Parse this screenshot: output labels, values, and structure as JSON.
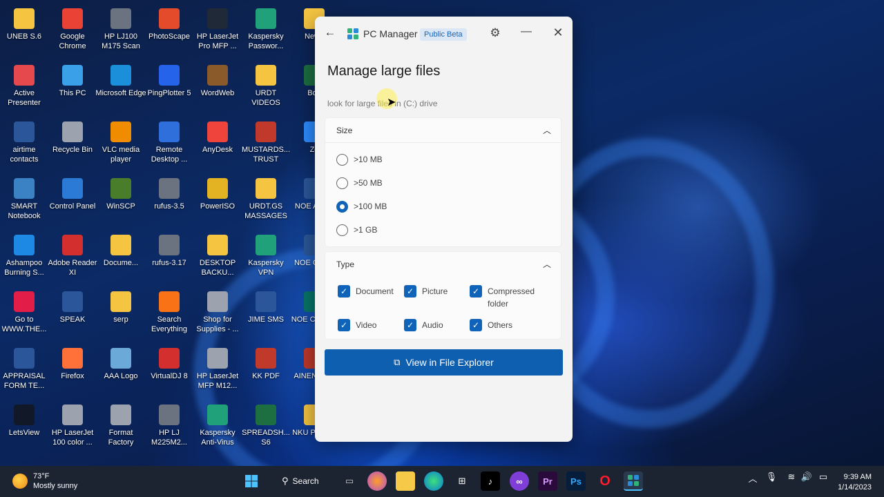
{
  "desktop": {
    "icons": [
      {
        "label": "UNEB S.6",
        "icon": "folder-icon"
      },
      {
        "label": "Google Chrome",
        "icon": "chrome-icon"
      },
      {
        "label": "HP LJ100 M175 Scan",
        "icon": "scanner-icon"
      },
      {
        "label": "PhotoScape",
        "icon": "photoscape-icon"
      },
      {
        "label": "HP LaserJet Pro MFP ...",
        "icon": "hp-icon"
      },
      {
        "label": "Kaspersky Passwor...",
        "icon": "kaspersky-password-icon"
      },
      {
        "label": "New f",
        "icon": "folder-icon"
      },
      {
        "label": "Active Presenter",
        "icon": "active-presenter-icon"
      },
      {
        "label": "This PC",
        "icon": "this-pc-icon"
      },
      {
        "label": "Microsoft Edge",
        "icon": "edge-icon"
      },
      {
        "label": "PingPlotter 5",
        "icon": "pingplotter-icon"
      },
      {
        "label": "WordWeb",
        "icon": "wordweb-icon"
      },
      {
        "label": "URDT VIDEOS",
        "icon": "folder-icon"
      },
      {
        "label": "Boo",
        "icon": "excel-icon"
      },
      {
        "label": "airtime contacts",
        "icon": "word-icon"
      },
      {
        "label": "Recycle Bin",
        "icon": "recycle-bin-icon"
      },
      {
        "label": "VLC media player",
        "icon": "vlc-icon"
      },
      {
        "label": "Remote Desktop ...",
        "icon": "remote-desktop-icon"
      },
      {
        "label": "AnyDesk",
        "icon": "anydesk-icon"
      },
      {
        "label": "MUSTARDS... TRUST",
        "icon": "pdf-icon"
      },
      {
        "label": "Zo",
        "icon": "zoom-icon"
      },
      {
        "label": "SMART Notebook",
        "icon": "smart-notebook-icon"
      },
      {
        "label": "Control Panel",
        "icon": "control-panel-icon"
      },
      {
        "label": "WinSCP",
        "icon": "winscp-icon"
      },
      {
        "label": "rufus-3.5",
        "icon": "rufus-icon"
      },
      {
        "label": "PowerISO",
        "icon": "poweriso-icon"
      },
      {
        "label": "URDT.GS MASSAGES",
        "icon": "folder-icon"
      },
      {
        "label": "NOE APPR",
        "icon": "word-icon"
      },
      {
        "label": "Ashampoo Burning S...",
        "icon": "ashampoo-icon"
      },
      {
        "label": "Adobe Reader XI",
        "icon": "adobe-reader-icon"
      },
      {
        "label": "Docume...",
        "icon": "folder-icon"
      },
      {
        "label": "rufus-3.17",
        "icon": "rufus-icon"
      },
      {
        "label": "DESKTOP BACKU...",
        "icon": "folder-icon"
      },
      {
        "label": "Kaspersky VPN",
        "icon": "kaspersky-vpn-icon"
      },
      {
        "label": "NOE CONT",
        "icon": "word-icon"
      },
      {
        "label": "Go to WWW.THE...",
        "icon": "shortcut-icon"
      },
      {
        "label": "SPEAK",
        "icon": "word-icon"
      },
      {
        "label": "serp",
        "icon": "folder-icon"
      },
      {
        "label": "Search Everything",
        "icon": "search-everything-icon"
      },
      {
        "label": "Shop for Supplies - ...",
        "icon": "printer-icon"
      },
      {
        "label": "JIME SMS",
        "icon": "word-icon"
      },
      {
        "label": "NOE CERTIF",
        "icon": "publisher-icon"
      },
      {
        "label": "APPRAISAL FORM TE...",
        "icon": "word-icon"
      },
      {
        "label": "Firefox",
        "icon": "firefox-icon"
      },
      {
        "label": "AAA Logo",
        "icon": "aaa-logo-icon"
      },
      {
        "label": "VirtualDJ 8",
        "icon": "virtualdj-icon"
      },
      {
        "label": "HP LaserJet MFP M12...",
        "icon": "printer-icon"
      },
      {
        "label": "KK PDF",
        "icon": "pdf-icon"
      },
      {
        "label": "AINEN ANN",
        "icon": "pdf-icon"
      },
      {
        "label": "LetsView",
        "icon": "letsview-icon"
      },
      {
        "label": "HP LaserJet 100 color ...",
        "icon": "printer-icon"
      },
      {
        "label": "Format Factory",
        "icon": "format-factory-icon"
      },
      {
        "label": "HP LJ M225M2...",
        "icon": "scanner-icon"
      },
      {
        "label": "Kaspersky Anti-Virus",
        "icon": "kaspersky-icon"
      },
      {
        "label": "SPREADSH... S6",
        "icon": "excel-icon"
      },
      {
        "label": "NKU PRESE",
        "icon": "folder-icon"
      }
    ]
  },
  "window": {
    "back_icon": "back-arrow-icon",
    "app_title": "PC Manager",
    "badge": "Public Beta",
    "settings_icon": "gear-icon",
    "minimize_icon": "minimize-icon",
    "close_icon": "close-icon",
    "page_title": "Manage large files",
    "subtitle": "look for large files in (C:) drive",
    "size": {
      "header": "Size",
      "options": [
        {
          "label": ">10 MB",
          "checked": false
        },
        {
          "label": ">50 MB",
          "checked": false
        },
        {
          "label": ">100 MB",
          "checked": true
        },
        {
          "label": ">1 GB",
          "checked": false
        }
      ]
    },
    "type": {
      "header": "Type",
      "options": [
        {
          "label": "Document",
          "checked": true
        },
        {
          "label": "Picture",
          "checked": true
        },
        {
          "label": "Compressed folder",
          "checked": true
        },
        {
          "label": "Video",
          "checked": true
        },
        {
          "label": "Audio",
          "checked": true
        },
        {
          "label": "Others",
          "checked": true
        }
      ]
    },
    "primary_button": "View in File Explorer"
  },
  "taskbar": {
    "weather_temp": "73°F",
    "weather_desc": "Mostly sunny",
    "search_label": "Search",
    "pinned": [
      "windows-start-icon",
      "search-icon",
      "task-view-icon",
      "firefox-icon",
      "file-explorer-icon",
      "edge-icon",
      "store-icon",
      "tiktok-icon",
      "clipchamp-icon",
      "premiere-icon",
      "photoshop-icon",
      "opera-icon",
      "pc-manager-icon"
    ],
    "time": "9:39 AM",
    "date": "1/14/2023"
  }
}
